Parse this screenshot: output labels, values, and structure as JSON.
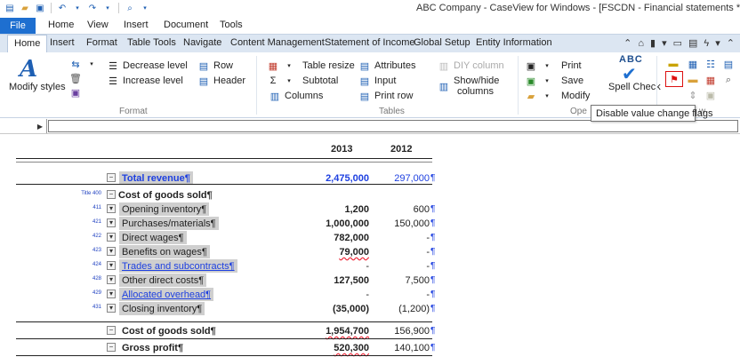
{
  "window": {
    "title": "ABC Company - CaseView for Windows - [FSCDN - Financial statements *]"
  },
  "menu": {
    "file": "File",
    "items": [
      "Home",
      "View",
      "Insert",
      "Document",
      "Tools"
    ]
  },
  "ribbon_tabs": [
    "Home",
    "Insert",
    "Format",
    "Table Tools",
    "Navigate",
    "Content Management",
    "Statement of Income",
    "Global Setup",
    "Entity Information"
  ],
  "ribbon": {
    "modify_styles": "Modify styles",
    "decrease_level": "Decrease level",
    "increase_level": "Increase level",
    "row": "Row",
    "header": "Header",
    "format_group": "Format",
    "table_resize": "Table resize",
    "subtotal": "Subtotal",
    "columns": "Columns",
    "attributes": "Attributes",
    "input": "Input",
    "print_row": "Print row",
    "diy_column": "DIY column",
    "show_hide_columns_1": "Show/hide",
    "show_hide_columns_2": "columns",
    "tables_group": "Tables",
    "print": "Print",
    "save": "Save",
    "modify": "Modify",
    "open_group_partial": "Ope",
    "spell_check": "Spell Check",
    "spell_abc": "ABC",
    "view_group_partial": "w"
  },
  "tooltip": "Disable value change flags",
  "document": {
    "col_2013": "2013",
    "col_2012": "2012",
    "rows": [
      {
        "num": "",
        "label": "Total revenue¶",
        "style": "blueBold",
        "v13": "2,475,000",
        "v12": "297,000",
        "pil": "¶"
      },
      {
        "num": "Title 400",
        "label": "Cost of goods sold¶",
        "style": "title",
        "v13": "",
        "v12": "",
        "pil": ""
      },
      {
        "num": "411",
        "label": "Opening inventory¶",
        "style": "shaded",
        "v13": "1,200",
        "v12": "600",
        "pil": "¶"
      },
      {
        "num": "421",
        "label": "Purchases/materials¶",
        "style": "shaded",
        "v13": "1,000,000",
        "v12": "150,000",
        "pil": "¶"
      },
      {
        "num": "422",
        "label": "Direct wages¶",
        "style": "shaded",
        "v13": "782,000",
        "v12": "-",
        "pil": "¶"
      },
      {
        "num": "423",
        "label": "Benefits on wages¶",
        "style": "shaded",
        "v13": "79,000",
        "v12": "-",
        "pil": "¶"
      },
      {
        "num": "424",
        "label": "Trades and subcontracts¶",
        "style": "blue",
        "v13": "-",
        "v12": "-",
        "pil": "¶"
      },
      {
        "num": "428",
        "label": "Other direct costs¶",
        "style": "shaded",
        "v13": "127,500",
        "v12": "7,500",
        "pil": "¶"
      },
      {
        "num": "429",
        "label": "Allocated overhead¶",
        "style": "blue",
        "v13": "-",
        "v12": "-",
        "pil": "¶"
      },
      {
        "num": "431",
        "label": "Closing inventory¶",
        "style": "shaded",
        "v13": "(35,000)",
        "v12": "(1,200)",
        "pil": "¶"
      },
      {
        "num": "",
        "label": "Cost of goods sold¶",
        "style": "bold",
        "v13": "1,954,700",
        "v12": "156,900",
        "pil": "¶"
      },
      {
        "num": "",
        "label": "Gross profit¶",
        "style": "bold",
        "v13": "520,300",
        "v12": "140,100",
        "pil": "¶"
      }
    ]
  }
}
